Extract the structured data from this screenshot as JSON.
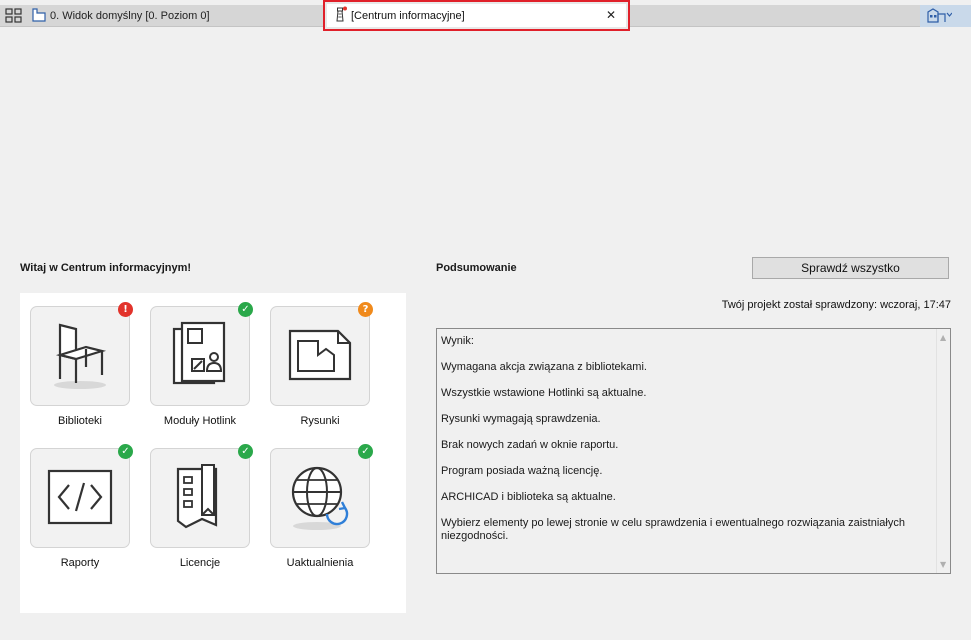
{
  "tabs": {
    "default_label": "0. Widok domyślny [0. Poziom 0]",
    "active_label": "[Centrum informacyjne]",
    "close_glyph": "✕"
  },
  "welcome_title": "Witaj w Centrum informacyjnym!",
  "tiles": [
    {
      "label": "Biblioteki",
      "icon": "chair-icon",
      "status": "error",
      "badge": "!"
    },
    {
      "label": "Moduły Hotlink",
      "icon": "hotlink-modules-icon",
      "status": "ok",
      "badge": "✓"
    },
    {
      "label": "Rysunki",
      "icon": "drawings-icon",
      "status": "warning",
      "badge": "?"
    },
    {
      "label": "Raporty",
      "icon": "reports-code-icon",
      "status": "ok",
      "badge": "✓"
    },
    {
      "label": "Licencje",
      "icon": "license-icon",
      "status": "ok",
      "badge": "✓"
    },
    {
      "label": "Uaktualnienia",
      "icon": "globe-update-icon",
      "status": "ok",
      "badge": "✓"
    }
  ],
  "summary": {
    "title": "Podsumowanie",
    "check_all_label": "Sprawdź wszystko",
    "checked_text": "Twój projekt został sprawdzony: wczoraj, 17:47",
    "result_lines": [
      "Wynik:",
      "Wymagana akcja związana z bibliotekami.",
      "Wszystkie wstawione Hotlinki są aktualne.",
      "Rysunki wymagają sprawdzenia.",
      "Brak nowych zadań w oknie raportu.",
      "Program posiada ważną licencję.",
      "ARCHICAD i biblioteka są aktualne.",
      "Wybierz elementy po lewej stronie w celu sprawdzenia i ewentualnego rozwiązania zaistniałych niezgodności."
    ]
  },
  "colors": {
    "accent_red": "#e0202a",
    "ok_green": "#2aa84a",
    "error_red": "#e2332b",
    "warning_orange": "#f08a1c"
  }
}
